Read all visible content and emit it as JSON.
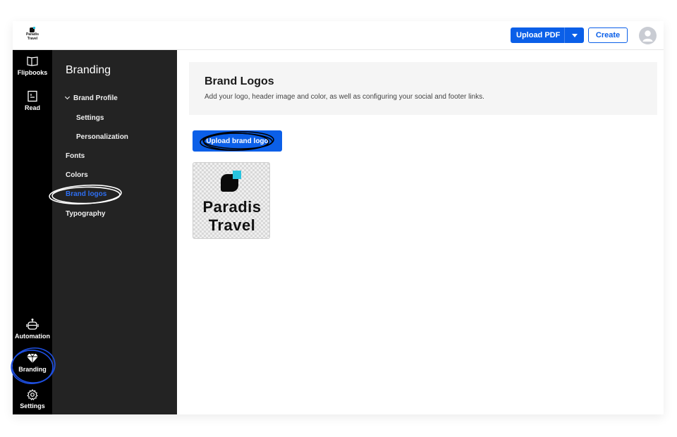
{
  "header": {
    "logo_line1": "Paradis",
    "logo_line2": "Travel",
    "upload_pdf_label": "Upload PDF",
    "create_label": "Create"
  },
  "rail": {
    "items": [
      {
        "label": "Flipbooks",
        "icon": "book-open-icon"
      },
      {
        "label": "Read",
        "icon": "document-icon"
      },
      {
        "label": "Automation",
        "icon": "robot-icon"
      },
      {
        "label": "Branding",
        "icon": "diamond-icon",
        "active": true
      },
      {
        "label": "Settings",
        "icon": "gear-icon"
      }
    ]
  },
  "subnav": {
    "title": "Branding",
    "items": [
      {
        "label": "Brand Profile",
        "expanded": true
      },
      {
        "label": "Settings"
      },
      {
        "label": "Personalization"
      },
      {
        "label": "Fonts"
      },
      {
        "label": "Colors"
      },
      {
        "label": "Brand logos",
        "active": true
      },
      {
        "label": "Typography"
      }
    ]
  },
  "main": {
    "title": "Brand Logos",
    "description": "Add your logo, header image and color, as well as configuring your social and footer links.",
    "upload_button_label": "Upload brand logo",
    "logo_preview": {
      "line1": "Paradis",
      "line2": "Travel"
    }
  },
  "colors": {
    "accent": "#0b5fe8",
    "active_link": "#2e6ff2",
    "logo_cyan": "#27c3df"
  }
}
